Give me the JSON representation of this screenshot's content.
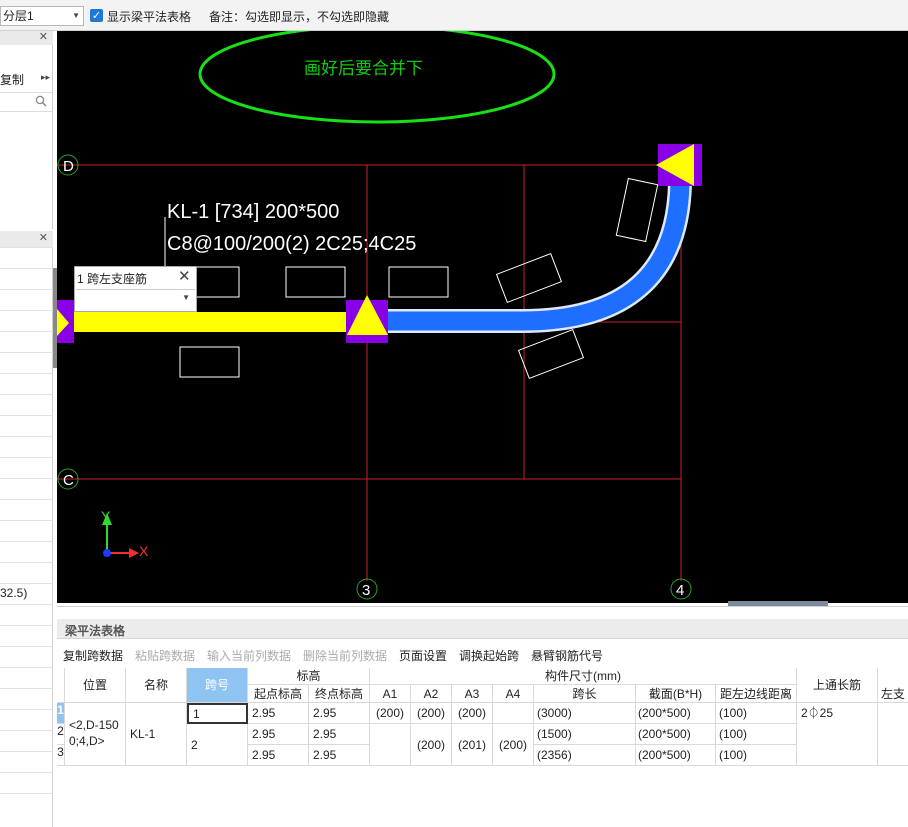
{
  "toolbar": {
    "floor_select": "分层1",
    "show_table_label": "显示梁平法表格",
    "show_table_checked": true,
    "note": "备注：勾选即显示，不勾选即隐藏"
  },
  "left_panel": {
    "copy_label": "复制",
    "value_text": "32.5)"
  },
  "canvas": {
    "annotation": "画好后要合并下",
    "beam_label_line1": "KL-1 [734] 200*500",
    "beam_label_line2": "C8@100/200(2) 2C25;4C25",
    "axis_D": "D",
    "axis_C": "C",
    "axis_3": "3",
    "axis_4": "4",
    "coord_x": "X",
    "coord_y": "Y",
    "popup": {
      "title": "1 跨左支座筋",
      "value": ""
    }
  },
  "bottom_panel": {
    "title": "梁平法表格",
    "buttons": [
      {
        "label": "复制跨数据",
        "enabled": true
      },
      {
        "label": "粘贴跨数据",
        "enabled": false
      },
      {
        "label": "输入当前列数据",
        "enabled": false
      },
      {
        "label": "删除当前列数据",
        "enabled": false
      },
      {
        "label": "页面设置",
        "enabled": true
      },
      {
        "label": "调换起始跨",
        "enabled": true
      },
      {
        "label": "悬臂钢筋代号",
        "enabled": true
      }
    ],
    "headers": {
      "position": "位置",
      "name": "名称",
      "span_no": "跨号",
      "elevation": "标高",
      "start_elev": "起点标高",
      "end_elev": "终点标高",
      "dimensions": "构件尺寸(mm)",
      "a1": "A1",
      "a2": "A2",
      "a3": "A3",
      "a4": "A4",
      "span_length": "跨长",
      "section": "截面(B*H)",
      "left_edge_dist": "距左边线距离",
      "top_rebar": "上通长筋",
      "left_support": "左支"
    },
    "row_numbers": [
      "1",
      "2",
      "3"
    ],
    "position_value": "<2,D-150 0;4,D>",
    "name_value": "KL-1",
    "rows": [
      {
        "span": "1",
        "start": "2.95",
        "end": "2.95",
        "a1": "(200)",
        "a2": "(200)",
        "a3": "(200)",
        "a4": "",
        "length": "(3000)",
        "section": "(200*500)",
        "left_dist": "(100)"
      },
      {
        "span": "2",
        "start": "2.95",
        "end": "2.95",
        "a1": "",
        "a2": "(200)",
        "a3": "(201)",
        "a4": "(200)",
        "length": "(1500)",
        "section": "(200*500)",
        "left_dist": "(100)"
      },
      {
        "span": "",
        "start": "2.95",
        "end": "2.95",
        "a1": "",
        "a2": "",
        "a3": "",
        "a4": "",
        "length": "(2356)",
        "section": "(200*500)",
        "left_dist": "(100)"
      }
    ],
    "top_rebar_value": "2⏀25"
  },
  "colors": {
    "canvas_bg": "#000000",
    "grid_line": "#c8202a",
    "beam_yellow": "#ffff00",
    "beam_blue": "#1e6fff",
    "support_purple": "#8a00e6",
    "annotation_green": "#18e018",
    "selected_header": "#8fc3f2"
  }
}
